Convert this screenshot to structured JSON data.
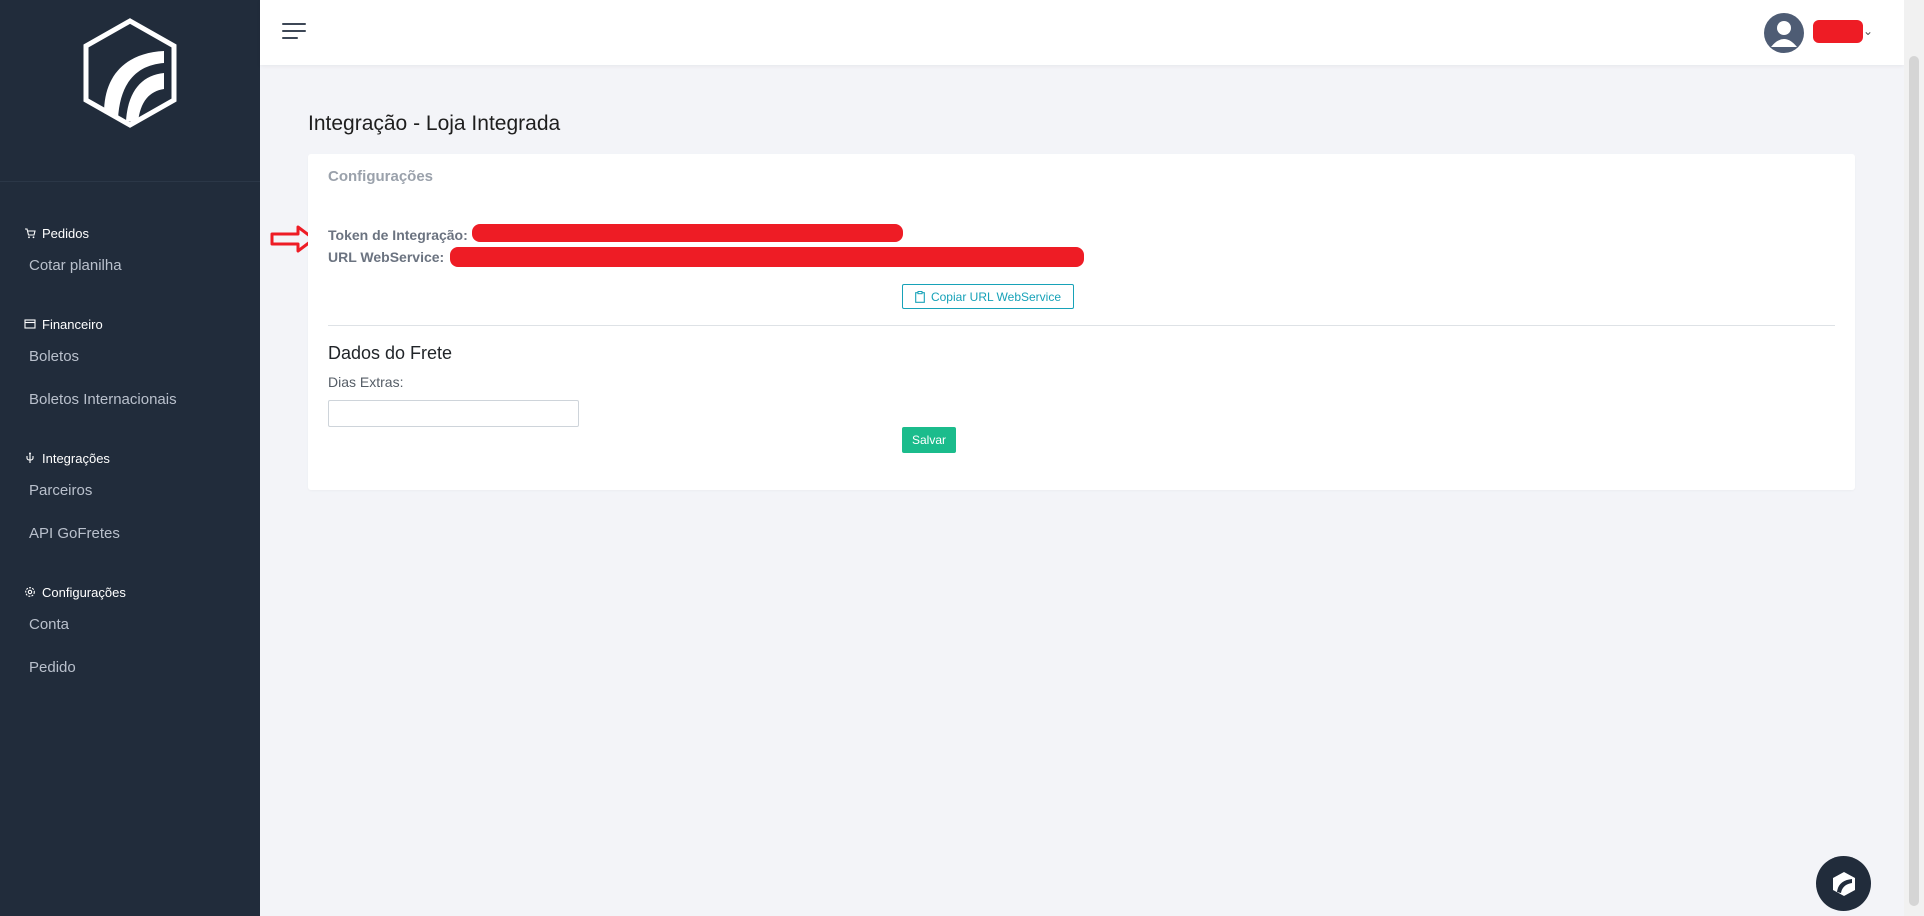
{
  "sidebar": {
    "sections": [
      {
        "label": "Pedidos",
        "icon": "cart-icon",
        "items": [
          {
            "label": "Cotar planilha"
          }
        ]
      },
      {
        "label": "Financeiro",
        "icon": "wallet-icon",
        "items": [
          {
            "label": "Boletos"
          },
          {
            "label": "Boletos Internacionais"
          }
        ]
      },
      {
        "label": "Integrações",
        "icon": "plug-icon",
        "items": [
          {
            "label": "Parceiros"
          },
          {
            "label": "API GoFretes"
          }
        ]
      },
      {
        "label": "Configurações",
        "icon": "gear-icon",
        "items": [
          {
            "label": "Conta"
          },
          {
            "label": "Pedido"
          }
        ]
      }
    ]
  },
  "page": {
    "title": "Integração - Loja Integrada"
  },
  "card": {
    "header": "Configurações",
    "token_label": "Token de Integração:",
    "url_label": "URL WebService:",
    "copy_button": "Copiar URL WebService",
    "freight_title": "Dados do Frete",
    "extra_days_label": "Dias Extras:",
    "extra_days_value": "",
    "save_button": "Salvar"
  },
  "colors": {
    "sidebar_bg": "#212c3b",
    "accent_teal": "#17a2b8",
    "save_green": "#1bbc8c",
    "redaction": "#ee1c25"
  }
}
